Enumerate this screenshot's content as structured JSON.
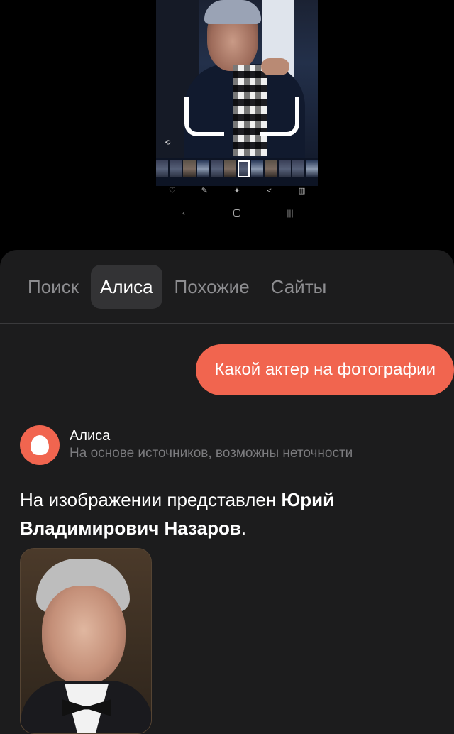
{
  "preview": {
    "crop_frame": "crop-corners",
    "thumbnails_count": 12,
    "action_icons": [
      "heart-icon",
      "pencil-icon",
      "sparkle-icon",
      "share-icon",
      "trash-icon"
    ],
    "system_nav_icons": [
      "back-icon",
      "home-icon",
      "recents-icon"
    ]
  },
  "tabs": [
    {
      "label": "Поиск",
      "active": false
    },
    {
      "label": "Алиса",
      "active": true
    },
    {
      "label": "Похожие",
      "active": false
    },
    {
      "label": "Сайты",
      "active": false
    }
  ],
  "chat": {
    "user_message": "Какой актер на фотографии",
    "assistant": {
      "name": "Алиса",
      "note": "На основе источников, возможны неточности",
      "answer_prefix": "На изображении представлен ",
      "answer_bold": "Юрий Владимирович Назаров",
      "answer_suffix": "."
    }
  },
  "colors": {
    "accent": "#f1654f",
    "sheet_bg": "#1c1c1d",
    "tab_active_bg": "#333335",
    "muted_text": "#8d8d90"
  }
}
